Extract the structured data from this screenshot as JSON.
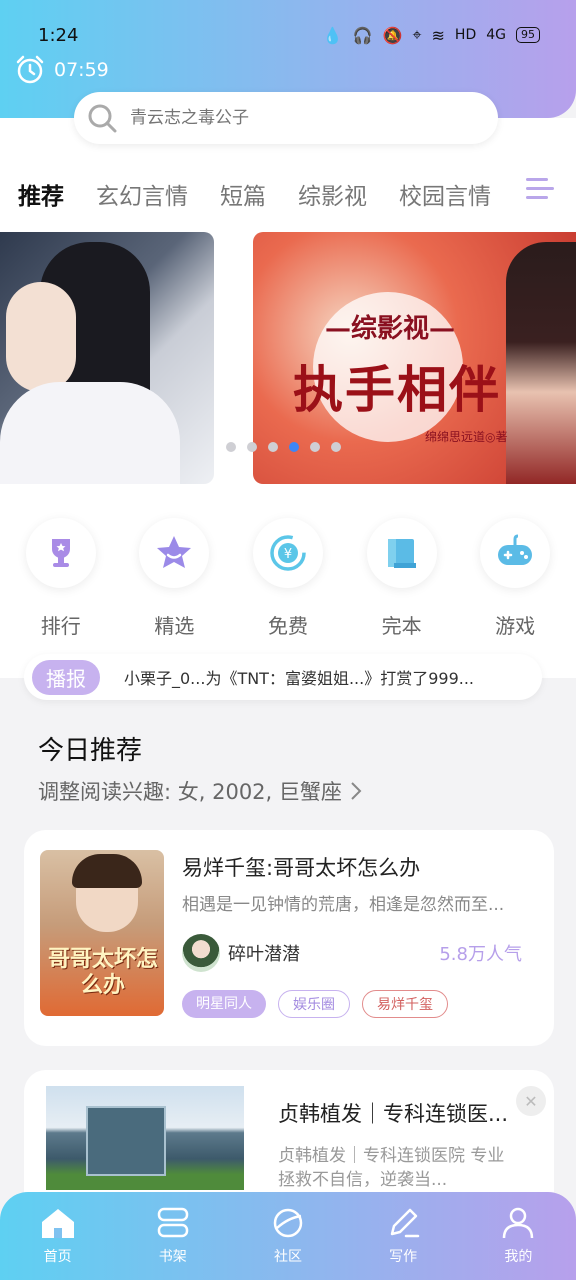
{
  "status_bar": {
    "time": "1:24",
    "network": "HD",
    "signal": "4G",
    "battery": "95"
  },
  "alarm": {
    "time": "07:59"
  },
  "search": {
    "placeholder": "青云志之毒公子"
  },
  "tabs": [
    {
      "label": "推荐",
      "active": true
    },
    {
      "label": "玄幻言情"
    },
    {
      "label": "短篇"
    },
    {
      "label": "综影视"
    },
    {
      "label": "校园言情"
    }
  ],
  "banner": {
    "title_small": "—综影视—",
    "title_big": "执手相伴",
    "author": "绵绵思远道◎著",
    "active_dot": 3,
    "dot_count": 6
  },
  "quick_nav": [
    {
      "label": "排行",
      "icon": "trophy-icon"
    },
    {
      "label": "精选",
      "icon": "star-icon"
    },
    {
      "label": "免费",
      "icon": "yen-coin-icon"
    },
    {
      "label": "完本",
      "icon": "book-icon"
    },
    {
      "label": "游戏",
      "icon": "gamepad-icon"
    }
  ],
  "broadcast": {
    "badge": "播报",
    "text": "小栗子_0...为《TNT：富婆姐姐...》打赏了999..."
  },
  "today": {
    "title": "今日推荐",
    "subtitle": "调整阅读兴趣: 女, 2002, 巨蟹座"
  },
  "book": {
    "title": "易烊千玺:哥哥太坏怎么办",
    "description": "相遇是一见钟情的荒唐，相逢是忽然而至...",
    "author": "碎叶潜潜",
    "popularity": "5.8万人气",
    "cover_title": "哥哥太坏怎么办",
    "tags": [
      "明星同人",
      "娱乐圈",
      "易烊千玺"
    ]
  },
  "ad": {
    "title": "贞韩植发｜专科连锁医...",
    "description": "贞韩植发｜专科连锁医院 专业拯救不自信，逆袭当...",
    "close": "✕"
  },
  "bottom_nav": [
    {
      "label": "首页",
      "icon": "home-icon"
    },
    {
      "label": "书架",
      "icon": "bookshelf-icon"
    },
    {
      "label": "社区",
      "icon": "planet-icon"
    },
    {
      "label": "写作",
      "icon": "pen-icon"
    },
    {
      "label": "我的",
      "icon": "user-icon"
    }
  ],
  "colors": {
    "accent_purple": "#c7b2ef",
    "header_cyan": "#5ed0f2",
    "header_violet": "#b7a0ec",
    "active_dot": "#3d86f5"
  }
}
